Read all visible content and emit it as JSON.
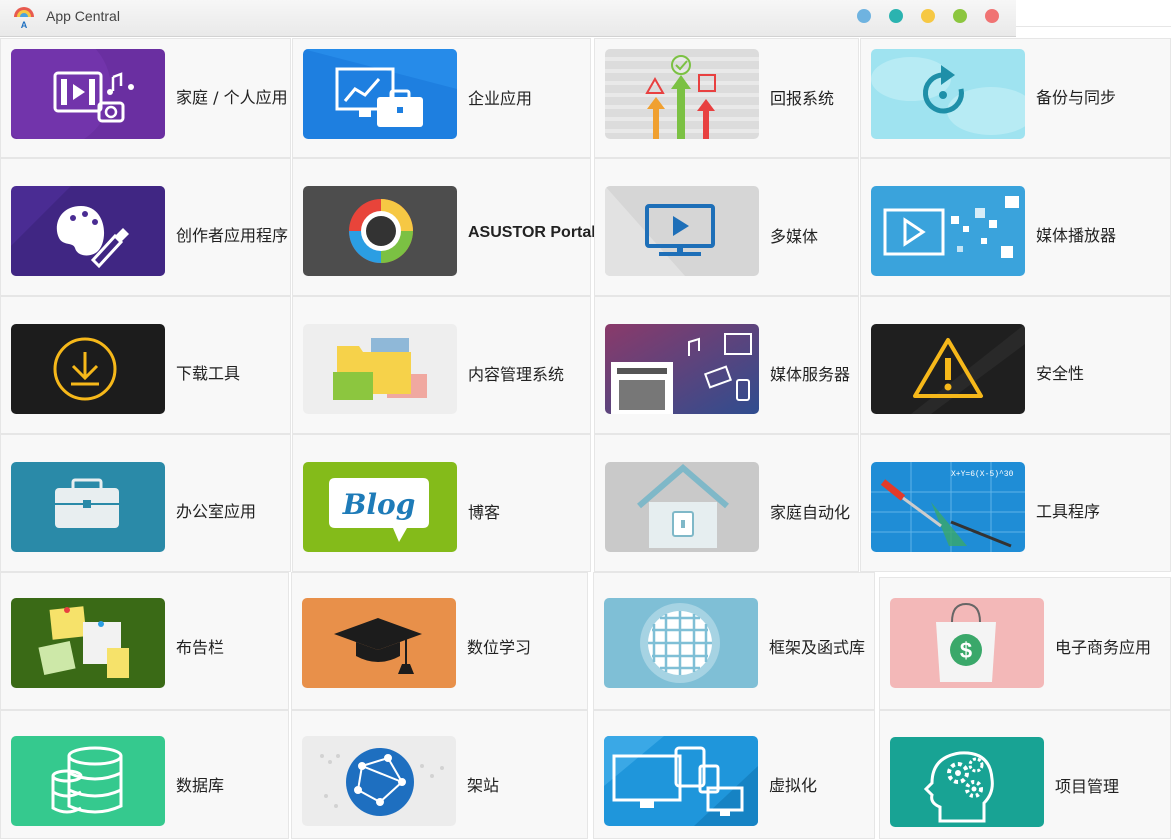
{
  "window": {
    "title": "App Central"
  },
  "title_dots": [
    "#6fb3e0",
    "#2bb3b0",
    "#f6c844",
    "#8cc63f",
    "#f07373"
  ],
  "categories": [
    {
      "label": "家庭 / 个人应用",
      "icon": "photo-video-music-icon",
      "color": "#6a2fa1"
    },
    {
      "label": "企业应用",
      "icon": "business-chart-briefcase-icon",
      "color": "#1e7fe0"
    },
    {
      "label": "回报系统",
      "icon": "feedback-arrows-icon",
      "color": "#dcdcdc"
    },
    {
      "label": "备份与同步",
      "icon": "backup-sync-icon",
      "color": "#9fe3f0"
    },
    {
      "label": "创作者应用程序",
      "icon": "palette-brush-icon",
      "color": "#4a2c93"
    },
    {
      "label": "ASUSTOR Portal",
      "icon": "portal-ring-icon",
      "color": "#4d4d4d"
    },
    {
      "label": "多媒体",
      "icon": "monitor-play-icon",
      "color": "#d6d6d6"
    },
    {
      "label": "媒体播放器",
      "icon": "media-player-icon",
      "color": "#3aa3dc"
    },
    {
      "label": "下载工具",
      "icon": "download-icon",
      "color": "#1c1c1c"
    },
    {
      "label": "内容管理系统",
      "icon": "folders-icon",
      "color": "#eeeeee"
    },
    {
      "label": "媒体服务器",
      "icon": "media-server-icon",
      "color": "#4b3a7a"
    },
    {
      "label": "安全性",
      "icon": "warning-icon",
      "color": "#1f1f1f"
    },
    {
      "label": "办公室应用",
      "icon": "briefcase-icon",
      "color": "#2a8aa8"
    },
    {
      "label": "博客",
      "icon": "blog-bubble-icon",
      "color": "#84bb1a"
    },
    {
      "label": "家庭自动化",
      "icon": "smart-home-icon",
      "color": "#c9c9c9"
    },
    {
      "label": "工具程序",
      "icon": "tools-blueprint-icon",
      "color": "#1f8dd6"
    },
    {
      "label": "布告栏",
      "icon": "bulletin-notes-icon",
      "color": "#3a6a16"
    },
    {
      "label": "数位学习",
      "icon": "graduation-cap-icon",
      "color": "#e8904a"
    },
    {
      "label": "框架及函式库",
      "icon": "disco-ball-icon",
      "color": "#7fbfd6"
    },
    {
      "label": "电子商务应用",
      "icon": "shopping-bag-dollar-icon",
      "color": "#f3b8b8"
    },
    {
      "label": "数据库",
      "icon": "database-icon",
      "color": "#35c98e"
    },
    {
      "label": "架站",
      "icon": "globe-network-icon",
      "color": "#ececec"
    },
    {
      "label": "虚拟化",
      "icon": "devices-virtualization-icon",
      "color": "#1f96db"
    },
    {
      "label": "项目管理",
      "icon": "head-gears-icon",
      "color": "#18a394"
    }
  ]
}
